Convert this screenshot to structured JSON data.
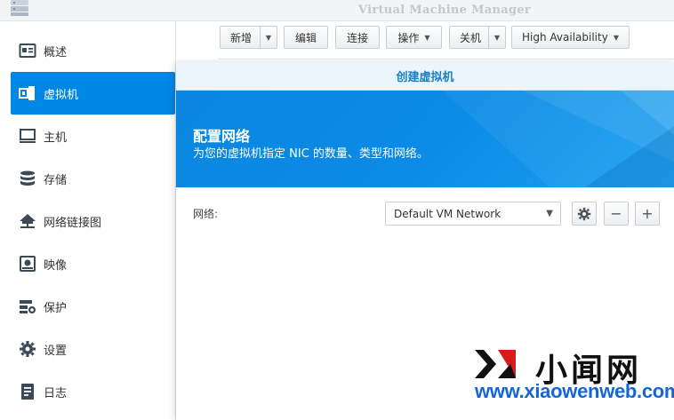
{
  "window": {
    "title": "Virtual Machine Manager"
  },
  "sidebar": {
    "items": [
      {
        "label": "概述",
        "icon": "overview-icon"
      },
      {
        "label": "虚拟机",
        "icon": "vm-icon",
        "active": true
      },
      {
        "label": "主机",
        "icon": "host-icon"
      },
      {
        "label": "存储",
        "icon": "storage-icon"
      },
      {
        "label": "网络链接图",
        "icon": "network-icon"
      },
      {
        "label": "映像",
        "icon": "image-icon"
      },
      {
        "label": "保护",
        "icon": "protection-icon"
      },
      {
        "label": "设置",
        "icon": "gear-icon"
      },
      {
        "label": "日志",
        "icon": "log-icon"
      }
    ]
  },
  "toolbar": {
    "new_label": "新增",
    "edit_label": "编辑",
    "connect_label": "连接",
    "action_label": "操作",
    "shutdown_label": "关机",
    "ha_label": "High Availability"
  },
  "modal": {
    "title": "创建虚拟机",
    "banner_title": "配置网络",
    "banner_subtitle": "为您的虚拟机指定 NIC 的数量、类型和网络。",
    "network_label": "网络:",
    "network_value": "Default VM Network"
  },
  "watermark": {
    "cn_text": "小闻网",
    "url": "www.xiaowenweb.com"
  },
  "colors": {
    "accent": "#0086e5",
    "banner": "#0b8ae6",
    "modal_title": "#1a7fc4",
    "watermark_blue": "#1565d8"
  }
}
